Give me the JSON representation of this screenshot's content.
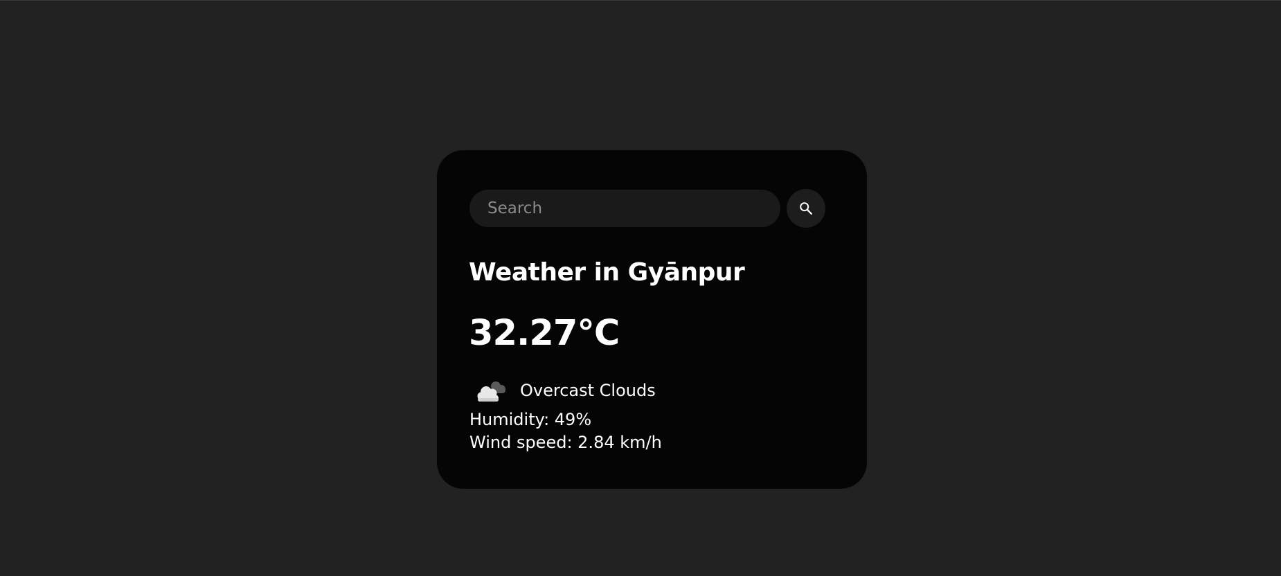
{
  "search": {
    "placeholder": "Search",
    "value": "",
    "icon": "search-icon"
  },
  "weather": {
    "title": "Weather in Gyānpur",
    "temperature": "32.27°C",
    "icon": "overcast-clouds-icon",
    "description": "Overcast Clouds",
    "humidity": "Humidity: 49%",
    "wind_speed": "Wind speed: 2.84 km/h"
  },
  "colors": {
    "page_background": "#222222",
    "card_background": "#050505",
    "input_background": "#1a1a1a",
    "text": "#ffffff"
  }
}
